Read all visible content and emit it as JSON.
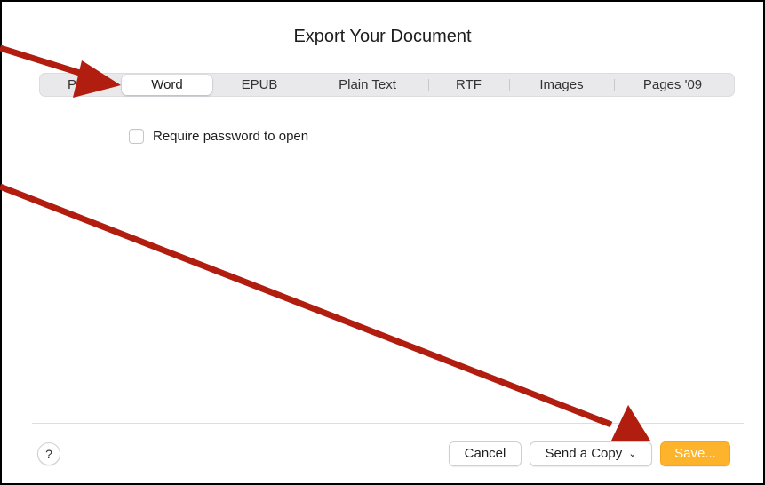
{
  "dialog": {
    "title": "Export Your Document"
  },
  "formats": {
    "items": [
      "PDF",
      "Word",
      "EPUB",
      "Plain Text",
      "RTF",
      "Images",
      "Pages '09"
    ],
    "selected": "Word"
  },
  "options": {
    "require_password_label": "Require password to open",
    "require_password_checked": false
  },
  "footer": {
    "help_label": "?",
    "cancel_label": "Cancel",
    "send_copy_label": "Send a Copy",
    "send_copy_chevron": "⌄",
    "save_label": "Save..."
  },
  "colors": {
    "accent": "#fdb42c",
    "annotation_arrow": "#b11d0f"
  }
}
